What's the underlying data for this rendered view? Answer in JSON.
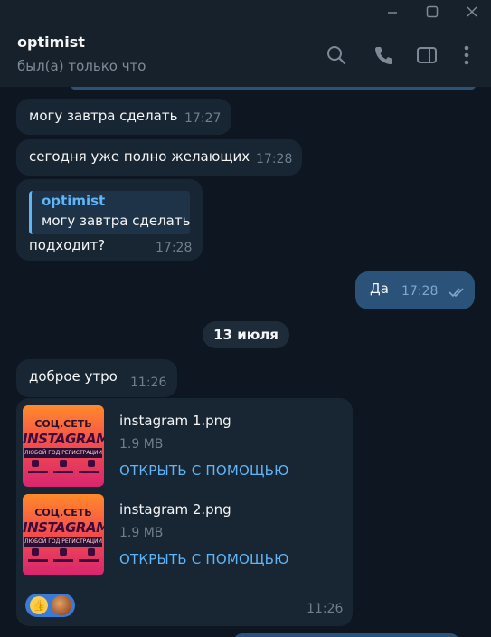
{
  "window": {
    "minimize_icon": "minimize-icon",
    "maximize_icon": "maximize-icon",
    "close_icon": "close-icon"
  },
  "header": {
    "name": "optimist",
    "status": "был(а) только что",
    "icons": [
      "search-icon",
      "phone-icon",
      "sidebar-toggle-icon",
      "more-vertical-icon"
    ]
  },
  "messages": [
    {
      "direction": "in",
      "text": "могу завтра сделать",
      "time": "17:27"
    },
    {
      "direction": "in",
      "text": "сегодня уже полно желающих",
      "time": "17:28"
    },
    {
      "direction": "in",
      "reply_author": "optimist",
      "reply_text": "могу завтра сделать",
      "text": "подходит?",
      "time": "17:28"
    },
    {
      "direction": "out",
      "text": "Да",
      "time": "17:28",
      "status_icon": "double-check-icon"
    }
  ],
  "date_separator": "13 июля",
  "messages_after": [
    {
      "direction": "in",
      "text": "доброе утро",
      "time": "11:26"
    }
  ],
  "files_message": {
    "files": [
      {
        "name": "instagram 1.png",
        "size": "1.9 MB",
        "action": "ОТКРЫТЬ С ПОМОЩЬЮ",
        "thumb_top": "СОЦ.СЕТЬ",
        "thumb_title": "INSTAGRAM",
        "thumb_sub": "ЛЮБОЙ ГОД РЕГИСТРАЦИИ"
      },
      {
        "name": "instagram 2.png",
        "size": "1.9 MB",
        "action": "ОТКРЫТЬ С ПОМОЩЬЮ",
        "thumb_top": "СОЦ.СЕТЬ",
        "thumb_title": "INSTAGRAM",
        "thumb_sub": "ЛЮБОЙ ГОД РЕГИСТРАЦИИ"
      }
    ],
    "reaction_emoji": "👍",
    "time": "11:26"
  },
  "colors": {
    "background": "#0e1621",
    "incoming_bubble": "#182533",
    "outgoing_bubble": "#2b5278",
    "accent": "#5eb5f7"
  }
}
